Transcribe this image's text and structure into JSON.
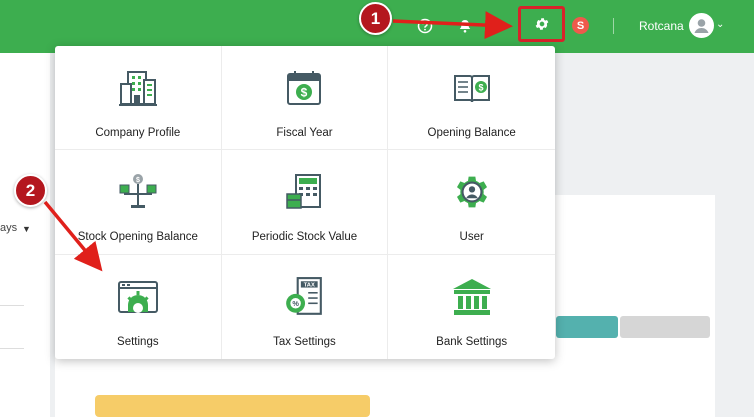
{
  "header": {
    "username": "Rotcana",
    "badge_letter": "S"
  },
  "steps": {
    "one": "1",
    "two": "2"
  },
  "background": {
    "partial_text": "ays"
  },
  "settings_menu": {
    "tiles": [
      {
        "label": "Company Profile",
        "icon": "company-building-icon"
      },
      {
        "label": "Fiscal Year",
        "icon": "calendar-dollar-icon"
      },
      {
        "label": "Opening Balance",
        "icon": "ledger-book-dollar-icon"
      },
      {
        "label": "Stock Opening Balance",
        "icon": "stock-scale-icon"
      },
      {
        "label": "Periodic Stock Value",
        "icon": "stock-calculator-icon"
      },
      {
        "label": "User",
        "icon": "user-gear-icon"
      },
      {
        "label": "Settings",
        "icon": "window-gear-icon"
      },
      {
        "label": "Tax Settings",
        "icon": "tax-document-icon"
      },
      {
        "label": "Bank Settings",
        "icon": "bank-building-icon"
      }
    ]
  },
  "colors": {
    "brand_green": "#3dae4f",
    "icon_dark": "#455a64",
    "marker_red": "#b4171e"
  }
}
